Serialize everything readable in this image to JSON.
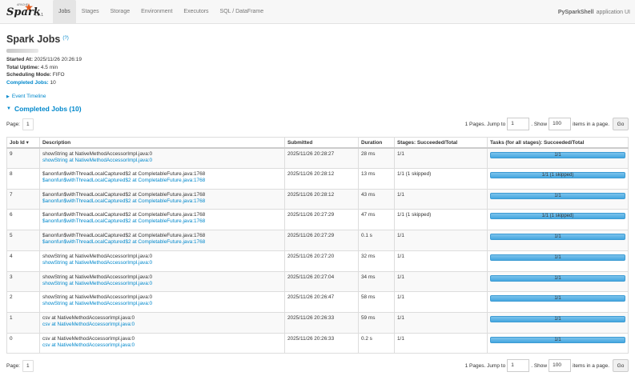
{
  "nav": {
    "logo_text": "Spark",
    "logo_apache": "APACHE",
    "version": "4.0.1",
    "tabs": [
      {
        "label": "Jobs",
        "active": true
      },
      {
        "label": "Stages",
        "active": false
      },
      {
        "label": "Storage",
        "active": false
      },
      {
        "label": "Environment",
        "active": false
      },
      {
        "label": "Executors",
        "active": false
      },
      {
        "label": "SQL / DataFrame",
        "active": false
      }
    ],
    "app_name": "PySparkShell",
    "app_suffix": "application UI"
  },
  "page": {
    "title": "Spark Jobs",
    "help": "(?)",
    "summary": {
      "started_label": "Started At:",
      "started_value": "2025/11/26 20:26:19",
      "uptime_label": "Total Uptime:",
      "uptime_value": "4.5 min",
      "mode_label": "Scheduling Mode:",
      "mode_value": "FIFO",
      "completed_label": "Completed Jobs:",
      "completed_value": "10"
    },
    "timeline_label": "Event Timeline",
    "completed_header": "Completed Jobs (10)"
  },
  "paging": {
    "page_label": "Page:",
    "page_value": "1",
    "pages_text": "1 Pages. Jump to",
    "jump_value": "1",
    "show_label": ". Show",
    "show_value": "100",
    "items_text": "items in a page.",
    "go_label": "Go"
  },
  "table": {
    "headers": [
      "Job Id ▾",
      "Description",
      "Submitted",
      "Duration",
      "Stages: Succeeded/Total",
      "Tasks (for all stages): Succeeded/Total"
    ],
    "rows": [
      {
        "id": "9",
        "desc": "showString at NativeMethodAccessorImpl.java:0",
        "link": "showString at NativeMethodAccessorImpl.java:0",
        "submitted": "2025/11/26 20:28:27",
        "duration": "28 ms",
        "stages": "1/1",
        "tasks": "1/1"
      },
      {
        "id": "8",
        "desc": "$anonfun$withThreadLocalCaptured$2 at CompletableFuture.java:1768",
        "link": "$anonfun$withThreadLocalCaptured$2 at CompletableFuture.java:1768",
        "submitted": "2025/11/26 20:28:12",
        "duration": "13 ms",
        "stages": "1/1 (1 skipped)",
        "tasks": "1/1 (1 skipped)"
      },
      {
        "id": "7",
        "desc": "$anonfun$withThreadLocalCaptured$2 at CompletableFuture.java:1768",
        "link": "$anonfun$withThreadLocalCaptured$2 at CompletableFuture.java:1768",
        "submitted": "2025/11/26 20:28:12",
        "duration": "43 ms",
        "stages": "1/1",
        "tasks": "1/1"
      },
      {
        "id": "6",
        "desc": "$anonfun$withThreadLocalCaptured$2 at CompletableFuture.java:1768",
        "link": "$anonfun$withThreadLocalCaptured$2 at CompletableFuture.java:1768",
        "submitted": "2025/11/26 20:27:29",
        "duration": "47 ms",
        "stages": "1/1 (1 skipped)",
        "tasks": "1/1 (1 skipped)"
      },
      {
        "id": "5",
        "desc": "$anonfun$withThreadLocalCaptured$2 at CompletableFuture.java:1768",
        "link": "$anonfun$withThreadLocalCaptured$2 at CompletableFuture.java:1768",
        "submitted": "2025/11/26 20:27:29",
        "duration": "0.1 s",
        "stages": "1/1",
        "tasks": "1/1"
      },
      {
        "id": "4",
        "desc": "showString at NativeMethodAccessorImpl.java:0",
        "link": "showString at NativeMethodAccessorImpl.java:0",
        "submitted": "2025/11/26 20:27:20",
        "duration": "32 ms",
        "stages": "1/1",
        "tasks": "1/1"
      },
      {
        "id": "3",
        "desc": "showString at NativeMethodAccessorImpl.java:0",
        "link": "showString at NativeMethodAccessorImpl.java:0",
        "submitted": "2025/11/26 20:27:04",
        "duration": "34 ms",
        "stages": "1/1",
        "tasks": "1/1"
      },
      {
        "id": "2",
        "desc": "showString at NativeMethodAccessorImpl.java:0",
        "link": "showString at NativeMethodAccessorImpl.java:0",
        "submitted": "2025/11/26 20:26:47",
        "duration": "58 ms",
        "stages": "1/1",
        "tasks": "1/1"
      },
      {
        "id": "1",
        "desc": "csv at NativeMethodAccessorImpl.java:0",
        "link": "csv at NativeMethodAccessorImpl.java:0",
        "submitted": "2025/11/26 20:26:33",
        "duration": "59 ms",
        "stages": "1/1",
        "tasks": "1/1"
      },
      {
        "id": "0",
        "desc": "csv at NativeMethodAccessorImpl.java:0",
        "link": "csv at NativeMethodAccessorImpl.java:0",
        "submitted": "2025/11/26 20:26:33",
        "duration": "0.2 s",
        "stages": "1/1",
        "tasks": "1/1"
      }
    ]
  },
  "colors": {
    "accent": "#0088cc",
    "progress": "#45a7e0",
    "logo_star": "#e25a1c"
  }
}
